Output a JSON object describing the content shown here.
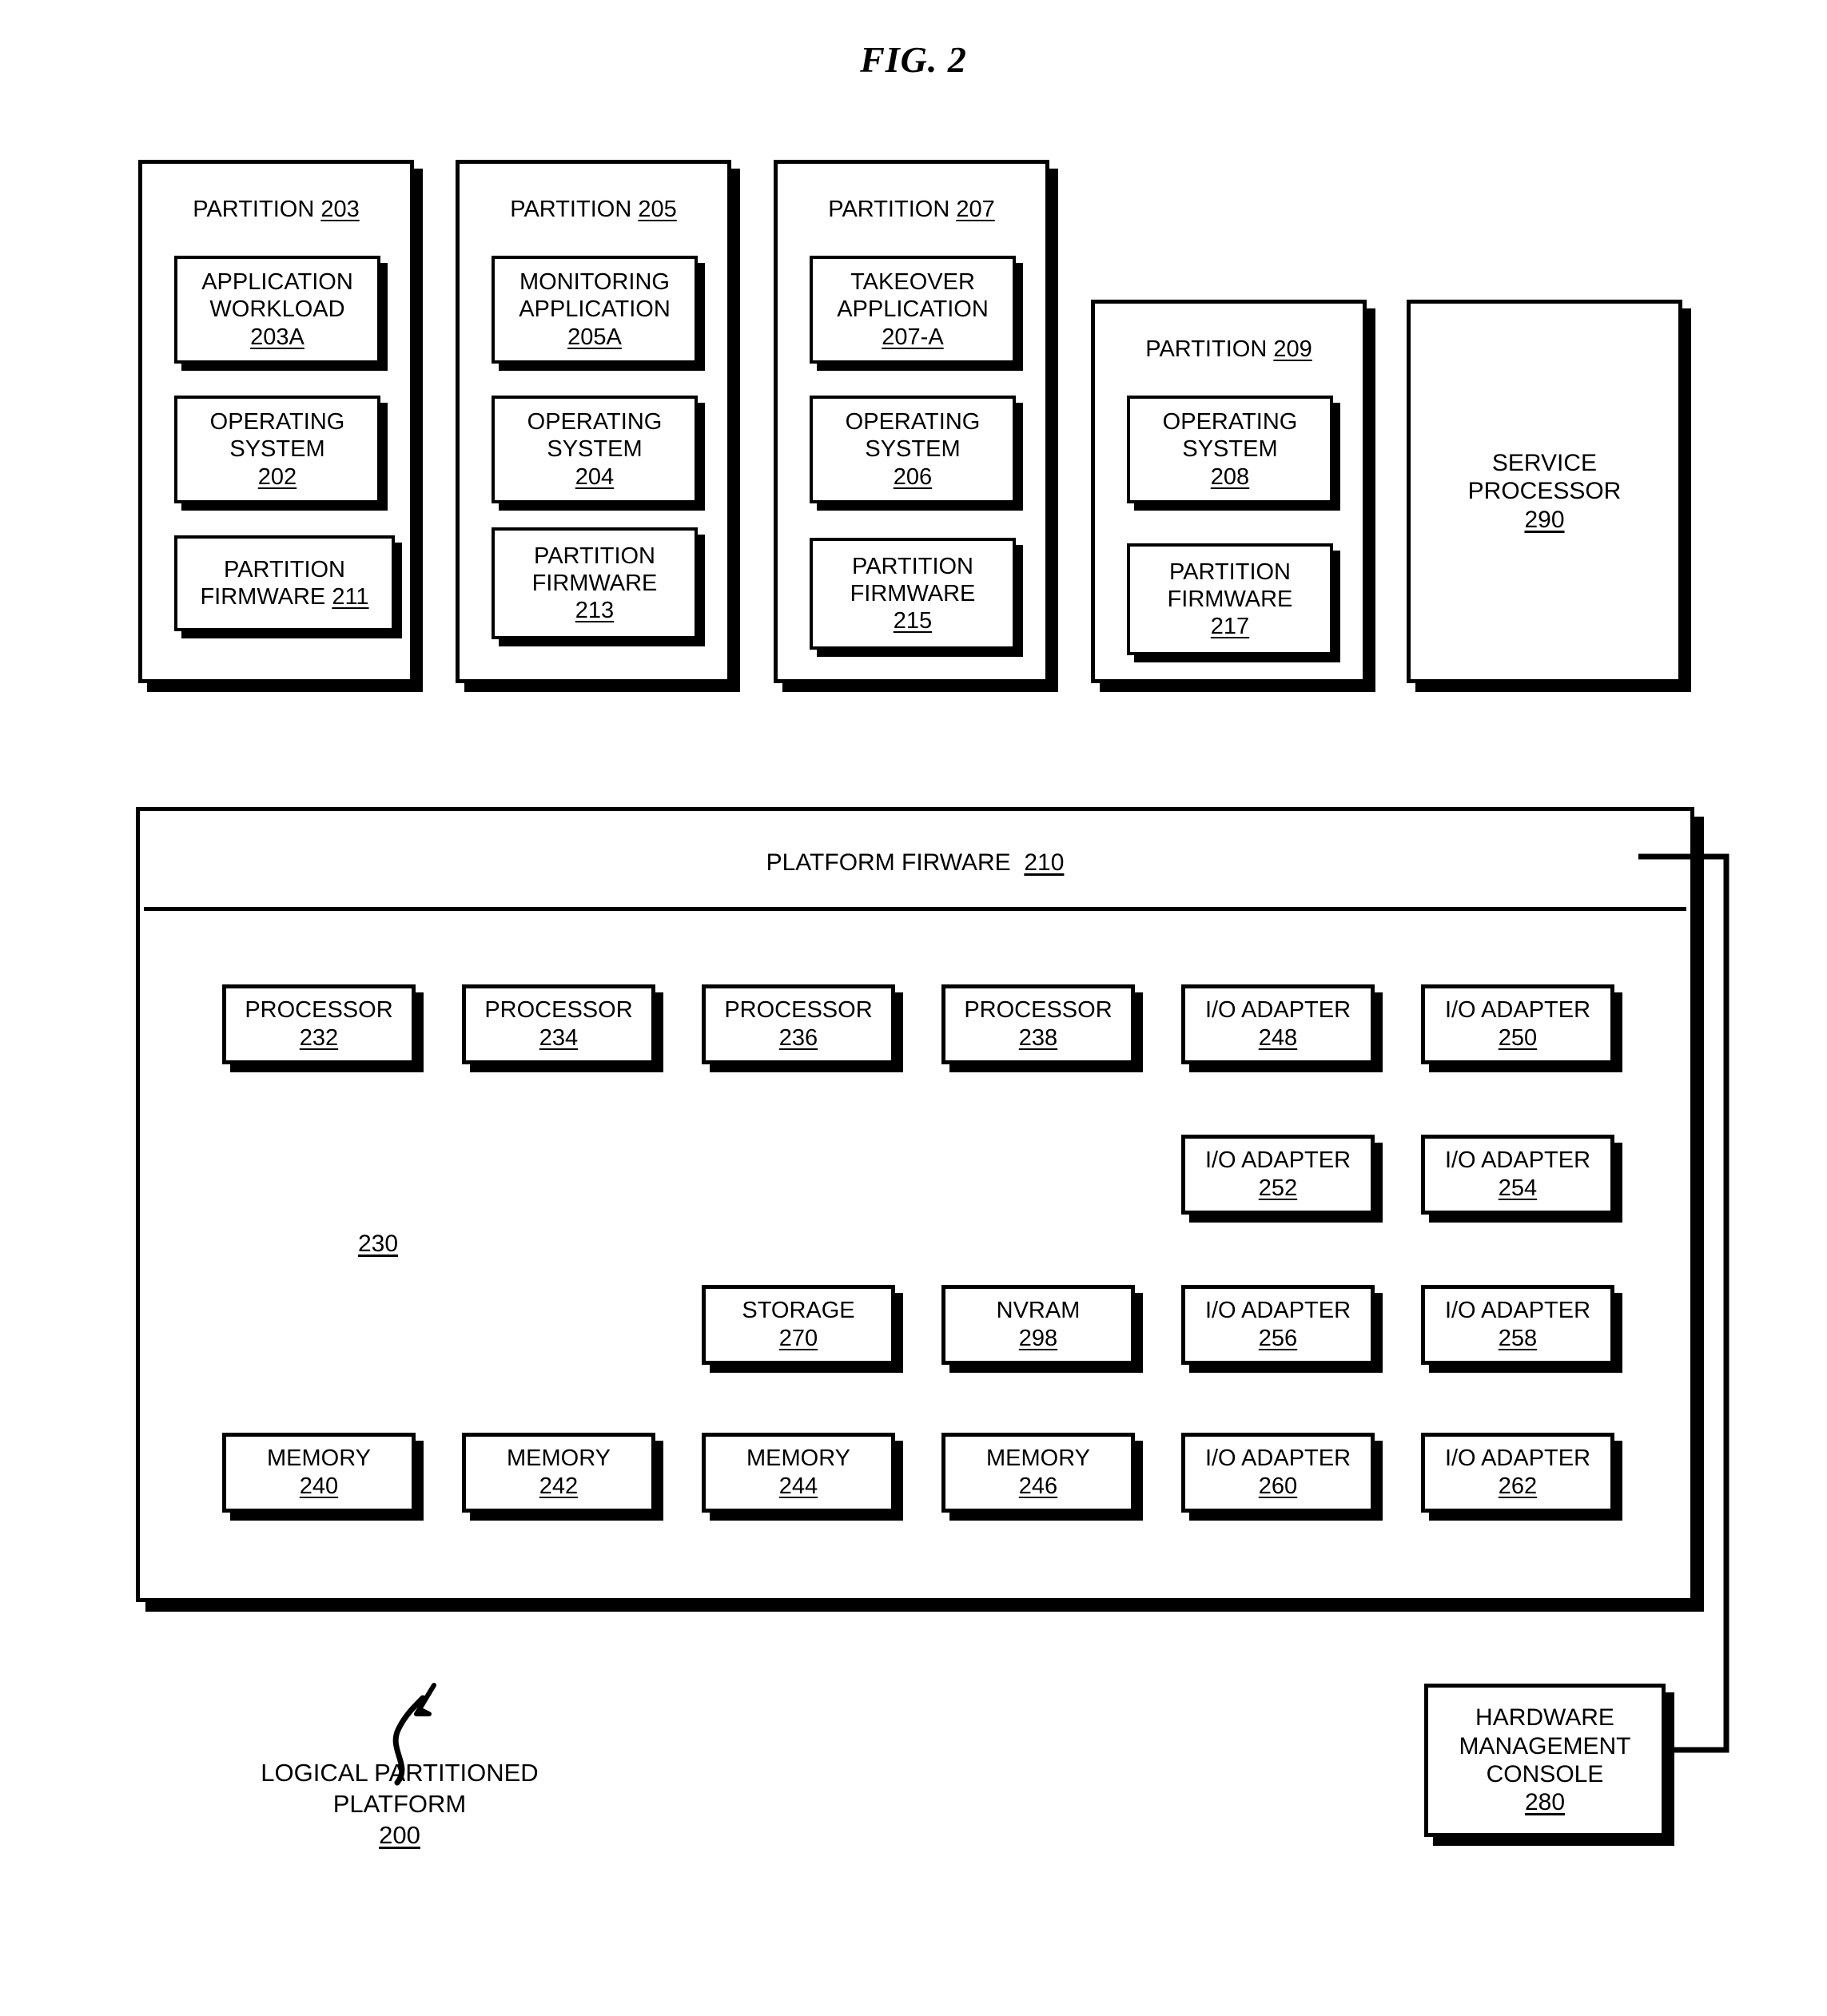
{
  "figure": {
    "title": "FIG. 2"
  },
  "partitions": [
    {
      "title_label": "PARTITION",
      "title_ref": "203",
      "components": [
        {
          "lines": [
            "APPLICATION",
            "WORKLOAD"
          ],
          "ref": "203A"
        },
        {
          "lines": [
            "OPERATING",
            "SYSTEM"
          ],
          "ref": "202"
        },
        {
          "lines": [
            "PARTITION",
            "FIRMWARE "
          ],
          "ref": "211",
          "inline_ref": true
        }
      ]
    },
    {
      "title_label": "PARTITION",
      "title_ref": "205",
      "components": [
        {
          "lines": [
            "MONITORING",
            "APPLICATION"
          ],
          "ref": "205A"
        },
        {
          "lines": [
            "OPERATING",
            "SYSTEM"
          ],
          "ref": "204"
        },
        {
          "lines": [
            "PARTITION",
            "FIRMWARE"
          ],
          "ref": "213"
        }
      ]
    },
    {
      "title_label": "PARTITION",
      "title_ref": "207",
      "components": [
        {
          "lines": [
            "TAKEOVER",
            "APPLICATION"
          ],
          "ref": "207-A"
        },
        {
          "lines": [
            "OPERATING",
            "SYSTEM"
          ],
          "ref": "206"
        },
        {
          "lines": [
            "PARTITION",
            "FIRMWARE"
          ],
          "ref": "215"
        }
      ]
    },
    {
      "title_label": "PARTITION",
      "title_ref": "209",
      "components": [
        {
          "lines": [
            "OPERATING",
            "SYSTEM"
          ],
          "ref": "208"
        },
        {
          "lines": [
            "PARTITION",
            "FIRMWARE"
          ],
          "ref": "217"
        }
      ]
    }
  ],
  "service_processor": {
    "lines": [
      "SERVICE",
      "PROCESSOR"
    ],
    "ref": "290"
  },
  "platform_firmware": {
    "title_label": "PLATFORM FIRWARE",
    "title_ref": "210",
    "pool_ref": "230"
  },
  "hardware": [
    {
      "label": "PROCESSOR",
      "ref": "232"
    },
    {
      "label": "PROCESSOR",
      "ref": "234"
    },
    {
      "label": "PROCESSOR",
      "ref": "236"
    },
    {
      "label": "PROCESSOR",
      "ref": "238"
    },
    {
      "label": "I/O ADAPTER",
      "ref": "248"
    },
    {
      "label": "I/O ADAPTER",
      "ref": "250"
    },
    {
      "label": "I/O ADAPTER",
      "ref": "252"
    },
    {
      "label": "I/O ADAPTER",
      "ref": "254"
    },
    {
      "label": "STORAGE",
      "ref": "270"
    },
    {
      "label": "NVRAM",
      "ref": "298"
    },
    {
      "label": "I/O ADAPTER",
      "ref": "256"
    },
    {
      "label": "I/O ADAPTER",
      "ref": "258"
    },
    {
      "label": "MEMORY",
      "ref": "240"
    },
    {
      "label": "MEMORY",
      "ref": "242"
    },
    {
      "label": "MEMORY",
      "ref": "244"
    },
    {
      "label": "MEMORY",
      "ref": "246"
    },
    {
      "label": "I/O ADAPTER",
      "ref": "260"
    },
    {
      "label": "I/O ADAPTER",
      "ref": "262"
    }
  ],
  "hmc": {
    "lines": [
      "HARDWARE",
      "MANAGEMENT",
      "CONSOLE"
    ],
    "ref": "280"
  },
  "caption": {
    "lines": [
      "LOGICAL PARTITIONED",
      "PLATFORM"
    ],
    "ref": "200"
  }
}
